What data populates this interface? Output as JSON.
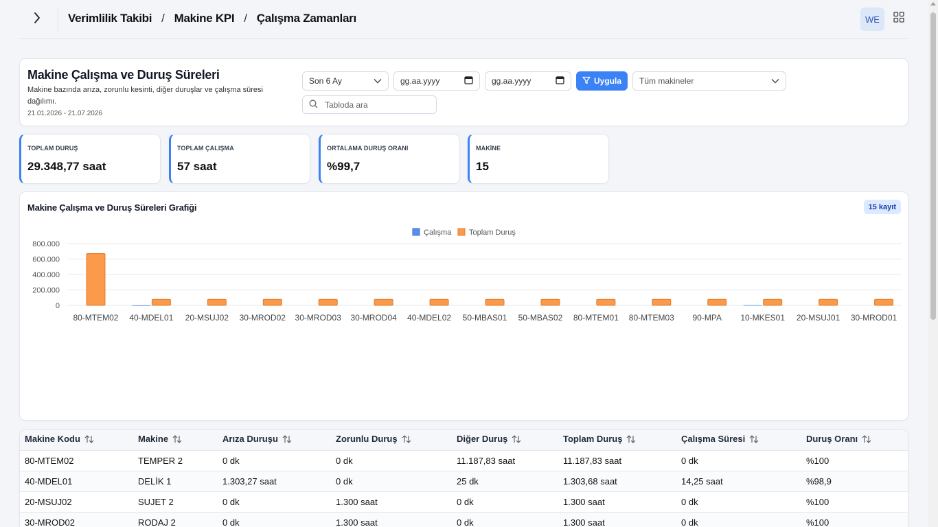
{
  "breadcrumb": [
    "Verimlilik Takibi",
    "Makine KPI",
    "Çalışma Zamanları"
  ],
  "user": {
    "initials": "WE"
  },
  "header": {
    "title": "Makine Çalışma ve Duruş Süreleri",
    "description": "Makine bazında arıza, zorunlu kesinti, diğer duruşlar ve çalışma süresi dağılımı.",
    "range": "21.01.2026 - 21.07.2026"
  },
  "filters": {
    "period": "Son 6 Ay",
    "date_start_placeholder": "gg.aa.yyyy",
    "date_end_placeholder": "gg.aa.yyyy",
    "apply_label": "Uygula",
    "machines": "Tüm makineler",
    "search_placeholder": "Tabloda ara"
  },
  "kpis": [
    {
      "label": "TOPLAM DURUŞ",
      "value": "29.348,77 saat"
    },
    {
      "label": "TOPLAM ÇALIŞMA",
      "value": "57 saat"
    },
    {
      "label": "ORTALAMA DURUŞ ORANI",
      "value": "%99,7"
    },
    {
      "label": "MAKİNE",
      "value": "15"
    }
  ],
  "chart": {
    "title": "Makine Çalışma ve Duruş Süreleri Grafiği",
    "badge": "15 kayıt"
  },
  "chart_data": {
    "type": "bar",
    "categories": [
      "80-MTEM02",
      "40-MDEL01",
      "20-MSUJ02",
      "30-MROD02",
      "30-MROD03",
      "30-MROD04",
      "40-MDEL02",
      "50-MBAS01",
      "50-MBAS02",
      "80-MTEM01",
      "80-MTEM03",
      "90-MPA",
      "10-MKES01",
      "20-MSUJ01",
      "30-MROD01"
    ],
    "series": [
      {
        "name": "Çalışma",
        "color": "#5b8def",
        "values": [
          0,
          855,
          0,
          0,
          0,
          0,
          0,
          0,
          0,
          0,
          0,
          0,
          2565,
          0,
          0
        ]
      },
      {
        "name": "Toplam Duruş",
        "color": "#fb9a4b",
        "values": [
          671270,
          78221,
          78000,
          78000,
          78000,
          78000,
          78000,
          78000,
          78000,
          78000,
          78000,
          78000,
          78000,
          78000,
          78000
        ]
      }
    ],
    "yticks": [
      "800.000",
      "600.000",
      "400.000",
      "200.000",
      "0"
    ],
    "ylim": [
      0,
      800000
    ],
    "grid": true,
    "legend": "top-center"
  },
  "table": {
    "columns": [
      "Makine Kodu",
      "Makine",
      "Arıza Duruşu",
      "Zorunlu Duruş",
      "Diğer Duruş",
      "Toplam Duruş",
      "Çalışma Süresi",
      "Duruş Oranı"
    ],
    "rows": [
      [
        "80-MTEM02",
        "TEMPER 2",
        "0 dk",
        "0 dk",
        "11.187,83 saat",
        "11.187,83 saat",
        "0 dk",
        "%100"
      ],
      [
        "40-MDEL01",
        "DELİK 1",
        "1.303,27 saat",
        "0 dk",
        "25 dk",
        "1.303,68 saat",
        "14,25 saat",
        "%98,9"
      ],
      [
        "20-MSUJ02",
        "SUJET 2",
        "0 dk",
        "1.300 saat",
        "0 dk",
        "1.300 saat",
        "0 dk",
        "%100"
      ],
      [
        "30-MROD02",
        "RODAJ 2",
        "0 dk",
        "1.300 saat",
        "0 dk",
        "1.300 saat",
        "0 dk",
        "%100"
      ]
    ]
  }
}
